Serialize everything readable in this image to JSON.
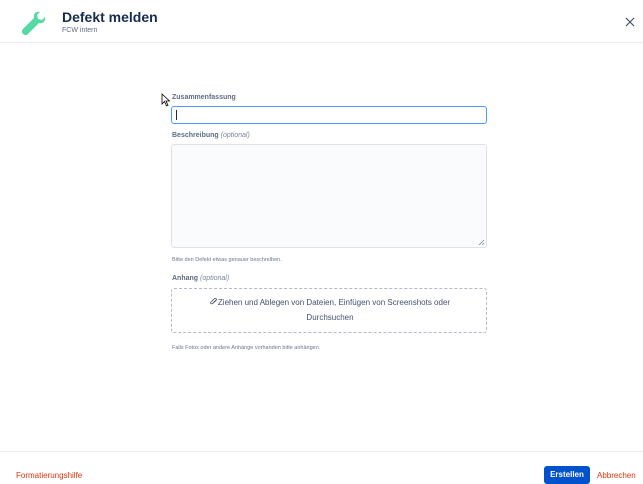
{
  "header": {
    "title": "Defekt melden",
    "subtitle": "FCW intern",
    "icon": "wrench-icon",
    "accent_color": "#57d9a3"
  },
  "form": {
    "summary": {
      "label": "Zusammenfassung",
      "value": ""
    },
    "description": {
      "label": "Beschreibung",
      "optional": "(optional)",
      "value": "",
      "help": "Bitte den Defekt etwas genauer beschreiben."
    },
    "attachment": {
      "label": "Anhang",
      "optional": "(optional)",
      "drop_text": "Ziehen und Ablegen von Dateien, Einfügen von Screenshots oder",
      "browse_label": "Durchsuchen",
      "help": "Falls Fotos oder andere Anhänge vorhanden bitte anhängen."
    }
  },
  "footer": {
    "format_help_label": "Formatierungshilfe",
    "create_label": "Erstellen",
    "cancel_label": "Abbrechen",
    "primary_color": "#0052cc",
    "link_color": "#de350b"
  }
}
